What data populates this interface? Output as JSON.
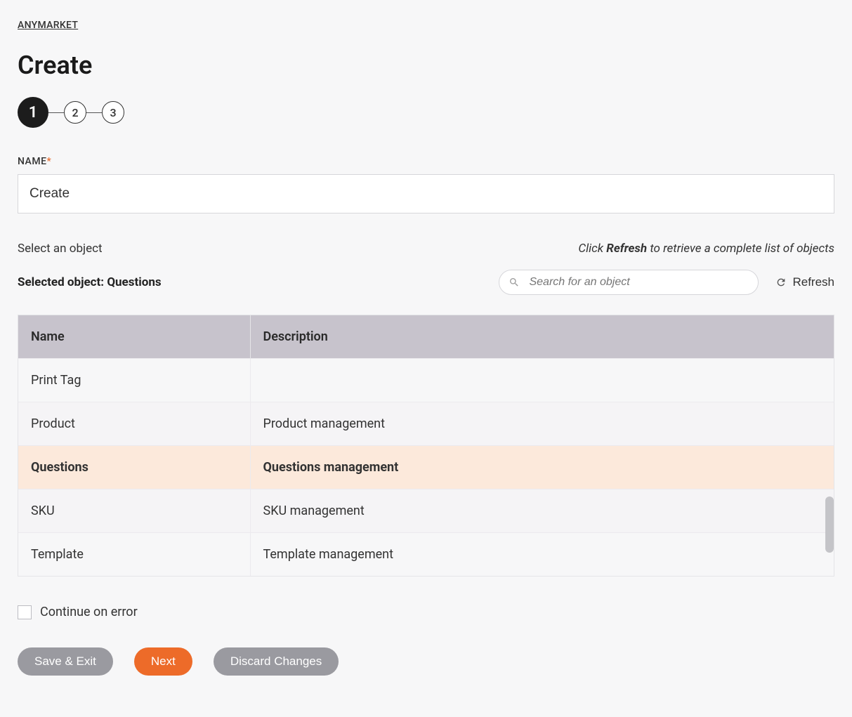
{
  "breadcrumb": "ANYMARKET",
  "page_title": "Create",
  "stepper": {
    "steps": [
      "1",
      "2",
      "3"
    ],
    "active_index": 0
  },
  "name_field": {
    "label": "NAME",
    "required_mark": "*",
    "value": "Create"
  },
  "select_object_hint": "Select an object",
  "refresh_hint_prefix": "Click ",
  "refresh_hint_bold": "Refresh",
  "refresh_hint_suffix": " to retrieve a complete list of objects",
  "selected_object_label": "Selected object: ",
  "selected_object_value": "Questions",
  "search": {
    "placeholder": "Search for an object"
  },
  "refresh_button": "Refresh",
  "table": {
    "columns": [
      "Name",
      "Description"
    ],
    "rows": [
      {
        "name": "Print Tag",
        "description": "",
        "selected": false
      },
      {
        "name": "Product",
        "description": "Product management",
        "selected": false
      },
      {
        "name": "Questions",
        "description": "Questions management",
        "selected": true
      },
      {
        "name": "SKU",
        "description": "SKU management",
        "selected": false
      },
      {
        "name": "Template",
        "description": "Template management",
        "selected": false
      }
    ]
  },
  "continue_checkbox": {
    "label": "Continue on error",
    "checked": false
  },
  "actions": {
    "save_exit": "Save & Exit",
    "next": "Next",
    "discard": "Discard Changes"
  }
}
